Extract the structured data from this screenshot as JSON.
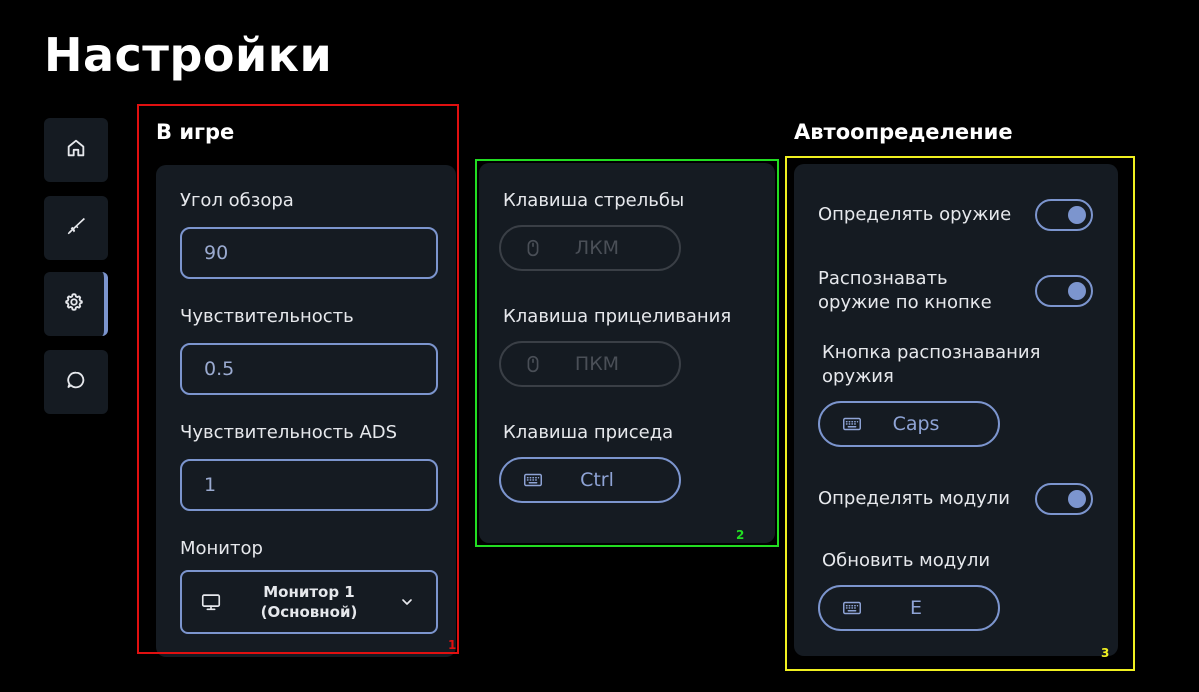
{
  "page": {
    "title": "Настройки"
  },
  "sidebar": {
    "items": [
      {
        "icon": "home-icon",
        "active": false
      },
      {
        "icon": "rifle-icon",
        "active": false
      },
      {
        "icon": "gear-icon",
        "active": true
      },
      {
        "icon": "chat-bubble-icon",
        "active": false
      }
    ]
  },
  "in_game": {
    "title": "В игре",
    "fov": {
      "label": "Угол обзора",
      "value": "90"
    },
    "sensitivity": {
      "label": "Чувствительность",
      "value": "0.5"
    },
    "ads_sensitivity": {
      "label": "Чувствительность ADS",
      "value": "1"
    },
    "monitor": {
      "label": "Монитор",
      "value_line1": "Монитор 1",
      "value_line2": "(Основной)"
    }
  },
  "keys": {
    "fire": {
      "label": "Клавиша стрельбы",
      "value": "ЛКМ",
      "icon": "mouse-icon",
      "disabled": true
    },
    "aim": {
      "label": "Клавиша прицеливания",
      "value": "ПКМ",
      "icon": "mouse-icon",
      "disabled": true
    },
    "crouch": {
      "label": "Клавиша приседа",
      "value": "Ctrl",
      "icon": "keyboard-icon",
      "disabled": false
    }
  },
  "auto": {
    "title": "Автоопределение",
    "detect_weapon": {
      "label": "Определять оружие",
      "on": true
    },
    "recognize_by_button": {
      "label_line1": "Распознавать",
      "label_line2": "оружие по кнопке",
      "on": true
    },
    "recognize_key": {
      "label_line1": "Кнопка распознавания",
      "label_line2": "оружия",
      "value": "Caps"
    },
    "detect_modules": {
      "label": "Определять модули",
      "on": true
    },
    "refresh_modules": {
      "label": "Обновить модули",
      "value": "E"
    }
  },
  "annotations": [
    {
      "number": "1",
      "color": "#e01010"
    },
    {
      "number": "2",
      "color": "#22dd22"
    },
    {
      "number": "3",
      "color": "#f0f020"
    }
  ],
  "colors": {
    "background": "#000000",
    "card": "#151b22",
    "accent": "#7c95ce",
    "disabled": "#3a3f46"
  }
}
